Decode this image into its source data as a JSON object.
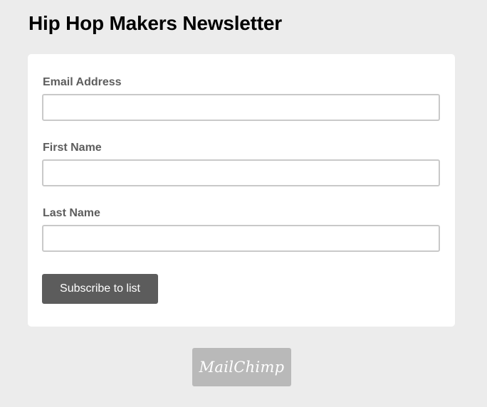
{
  "page": {
    "title": "Hip Hop Makers Newsletter"
  },
  "form": {
    "fields": [
      {
        "label": "Email Address",
        "value": "",
        "placeholder": ""
      },
      {
        "label": "First Name",
        "value": "",
        "placeholder": ""
      },
      {
        "label": "Last Name",
        "value": "",
        "placeholder": ""
      }
    ],
    "submit_label": "Subscribe to list"
  },
  "footer": {
    "badge_text": "MailChimp"
  },
  "colors": {
    "background": "#ececec",
    "card": "#ffffff",
    "label": "#5d5d5d",
    "input_border": "#c9c9c9",
    "button": "#5c5c5c",
    "badge": "#b9b9b9"
  }
}
